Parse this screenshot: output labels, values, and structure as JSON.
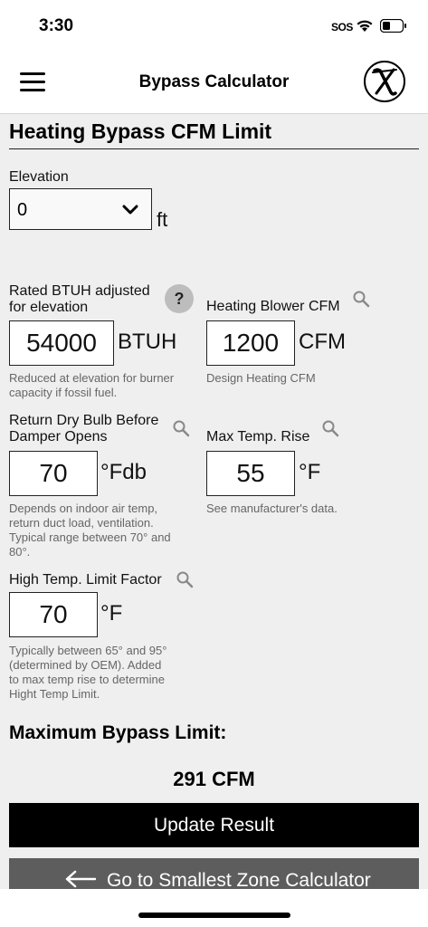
{
  "status": {
    "time": "3:30",
    "sos": "SOS"
  },
  "nav": {
    "title": "Bypass Calculator"
  },
  "section": {
    "title": "Heating Bypass CFM Limit"
  },
  "elevation": {
    "label": "Elevation",
    "value": "0",
    "unit": "ft"
  },
  "rated_btuh": {
    "label_line1": "Rated BTUH adjusted",
    "label_line2": "for elevation",
    "value": "54000",
    "unit": "BTUH",
    "help": "?",
    "hint_line1": "Reduced at elevation for burner",
    "hint_line2": "capacity if fossil fuel."
  },
  "blower_cfm": {
    "label": "Heating Blower CFM",
    "value": "1200",
    "unit": "CFM",
    "hint": "Design Heating CFM"
  },
  "return_dry_bulb": {
    "label_line1": "Return Dry Bulb Before",
    "label_line2": "Damper Opens",
    "value": "70",
    "unit": "°Fdb",
    "hint_line1": "Depends on indoor air temp,",
    "hint_line2": "return duct load, ventilation.",
    "hint_line3": "Typical range between 70° and",
    "hint_line4": "80°."
  },
  "max_temp_rise": {
    "label": "Max Temp. Rise",
    "value": "55",
    "unit": "°F",
    "hint": "See manufacturer's data."
  },
  "high_temp_limit": {
    "label": "High Temp. Limit Factor",
    "value": "70",
    "unit": "°F",
    "hint_line1": "Typically between 65° and 95°",
    "hint_line2": "(determined by OEM). Added",
    "hint_line3": "to max temp rise to determine",
    "hint_line4": "Hight Temp Limit."
  },
  "result": {
    "label": "Maximum Bypass Limit:",
    "value": "291 CFM"
  },
  "buttons": {
    "update": "Update Result",
    "zone": "Go to Smallest Zone Calculator"
  },
  "colors": {
    "primary_button": "#000000",
    "secondary_button": "#5d5d5d",
    "background": "#efefef",
    "hint_text": "#666666"
  }
}
